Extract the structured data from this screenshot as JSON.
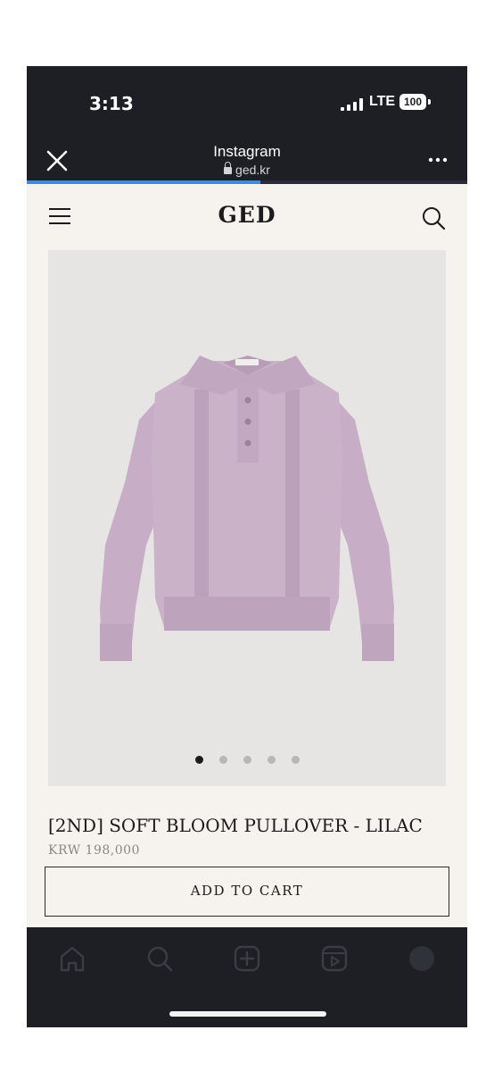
{
  "status_bar": {
    "time": "3:13",
    "network": "LTE",
    "battery": "100"
  },
  "browser": {
    "app_title": "Instagram",
    "url": "ged.kr",
    "load_progress": 0.53
  },
  "site": {
    "logo": "GED"
  },
  "product": {
    "title": "[2ND] SOFT BLOOM PULLOVER - LILAC",
    "price": "KRW 198,000",
    "add_to_cart_label": "ADD TO CART",
    "image_count": 5,
    "active_image": 1
  },
  "icons": {
    "browser": [
      "close-icon",
      "lock-icon",
      "more-icon"
    ],
    "site": [
      "hamburger-menu-icon",
      "search-icon"
    ],
    "tabbar": [
      "home-icon",
      "search-icon",
      "create-icon",
      "reels-icon",
      "profile-icon"
    ]
  },
  "colors": {
    "page_bg": "#f6f3ee",
    "chrome_bg": "#1d1f25",
    "progress": "#3a8de0",
    "sweater": "#c8b0c8"
  }
}
